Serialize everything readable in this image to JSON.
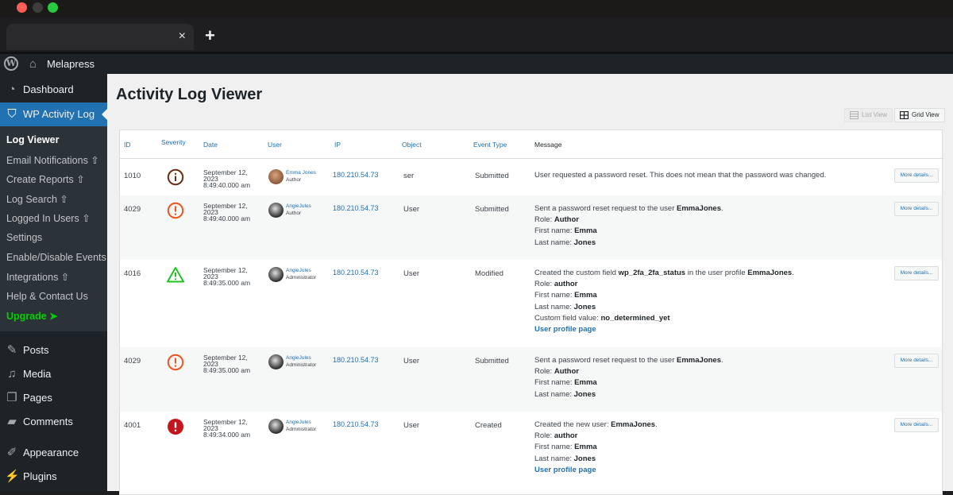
{
  "browser": {
    "window_controls": [
      {
        "name": "close",
        "color": "#ff5f57"
      },
      {
        "name": "minimize",
        "color": "#3d3d3d"
      },
      {
        "name": "maximize",
        "color": "#28c840"
      }
    ],
    "tab": {
      "title": "",
      "close_glyph": "×"
    },
    "new_tab_glyph": "+"
  },
  "admin_bar": {
    "wp_logo_glyph": "W",
    "home_glyph": "⌂",
    "site_name": "Melapress"
  },
  "sidebar": {
    "top_items": [
      {
        "label": "Dashboard",
        "icon": "dashboard-icon",
        "glyph": "◔"
      },
      {
        "label": "WP Activity Log",
        "icon": "shield-icon",
        "glyph": "⛉"
      }
    ],
    "submenu": [
      {
        "label": "Log Viewer",
        "suffix": ""
      },
      {
        "label": "Email Notifications",
        "suffix": " ⇧"
      },
      {
        "label": "Create Reports",
        "suffix": " ⇧"
      },
      {
        "label": "Log Search",
        "suffix": " ⇧"
      },
      {
        "label": "Logged In Users",
        "suffix": " ⇧"
      },
      {
        "label": "Settings",
        "suffix": ""
      },
      {
        "label": "Enable/Disable Events",
        "suffix": ""
      },
      {
        "label": "Integrations",
        "suffix": " ⇧"
      },
      {
        "label": "Help & Contact Us",
        "suffix": ""
      },
      {
        "label": "Upgrade",
        "suffix": " ➤"
      }
    ],
    "bottom_items": [
      {
        "label": "Posts",
        "icon": "pin-icon",
        "glyph": "✎"
      },
      {
        "label": "Media",
        "icon": "media-icon",
        "glyph": "♫"
      },
      {
        "label": "Pages",
        "icon": "pages-icon",
        "glyph": "❐"
      },
      {
        "label": "Comments",
        "icon": "comment-icon",
        "glyph": "▰"
      },
      {
        "label": "Appearance",
        "icon": "brush-icon",
        "glyph": "✐"
      },
      {
        "label": "Plugins",
        "icon": "plug-icon",
        "glyph": "⚡"
      }
    ]
  },
  "page": {
    "title": "Activity Log Viewer",
    "list_view_label": "List View",
    "grid_view_label": "Grid View"
  },
  "table": {
    "headers": [
      "ID",
      "Severity",
      "Date",
      "User",
      "IP",
      "Object",
      "Event Type",
      "Message"
    ],
    "more_label": "More details...",
    "rows": [
      {
        "id": "1010",
        "severity": "info",
        "date_l1": "September 12,",
        "date_l2": "2023",
        "date_l3": "8:49:40.000 am",
        "user": "Emma Jones",
        "role": "Author",
        "avatar": "#8a5a3c",
        "ip": "180.210.54.73",
        "object": "ser",
        "event_type": "Submitted",
        "message": [
          {
            "t": "User requested a password reset. This does not mean that the password was changed."
          }
        ]
      },
      {
        "id": "4029",
        "severity": "warning",
        "date_l1": "September 12,",
        "date_l2": "2023",
        "date_l3": "8:49:40.000 am",
        "user": "AngieJules",
        "role": "Author",
        "avatar": "#2a2a2a",
        "ip": "180.210.54.73",
        "object": "User",
        "event_type": "Submitted",
        "message": [
          {
            "t": "Sent a password reset request to the user ",
            "b": "EmmaJones",
            "e": "."
          },
          {
            "t": "Role: ",
            "b": "Author"
          },
          {
            "t": "First name: ",
            "b": "Emma"
          },
          {
            "t": "Last name: ",
            "b": "Jones"
          }
        ]
      },
      {
        "id": "4016",
        "severity": "notice",
        "date_l1": "September 12,",
        "date_l2": "2023",
        "date_l3": "8:49:35.000 am",
        "user": "AngieJules",
        "role": "Administrator",
        "avatar": "#2a2a2a",
        "ip": "180.210.54.73",
        "object": "User",
        "event_type": "Modified",
        "message": [
          {
            "t": "Created the custom field ",
            "b": "wp_2fa_2fa_status",
            "e": " in the user profile ",
            "b2": "EmmaJones",
            "e2": "."
          },
          {
            "t": "Role: ",
            "b": "author"
          },
          {
            "t": "First name: ",
            "b": "Emma"
          },
          {
            "t": "Last name: ",
            "b": "Jones"
          },
          {
            "t": "Custom field value: ",
            "b": "no_determined_yet"
          },
          {
            "link": "User profile page"
          }
        ]
      },
      {
        "id": "4029",
        "severity": "warning",
        "date_l1": "September 12,",
        "date_l2": "2023",
        "date_l3": "8:49:35.000 am",
        "user": "AngieJules",
        "role": "Administrator",
        "avatar": "#2a2a2a",
        "ip": "180.210.54.73",
        "object": "User",
        "event_type": "Submitted",
        "message": [
          {
            "t": "Sent a password reset request to the user ",
            "b": "EmmaJones",
            "e": "."
          },
          {
            "t": "Role: ",
            "b": "Author"
          },
          {
            "t": "First name: ",
            "b": "Emma"
          },
          {
            "t": "Last name: ",
            "b": "Jones"
          }
        ]
      },
      {
        "id": "4001",
        "severity": "critical",
        "date_l1": "September 12,",
        "date_l2": "2023",
        "date_l3": "8:49:34.000 am",
        "user": "AngieJules",
        "role": "Administrator",
        "avatar": "#2a2a2a",
        "ip": "180.210.54.73",
        "object": "User",
        "event_type": "Created",
        "message": [
          {
            "t": "Created the new user: ",
            "b": "EmmaJones",
            "e": "."
          },
          {
            "t": "Role: ",
            "b": "author"
          },
          {
            "t": "First name: ",
            "b": "Emma"
          },
          {
            "t": "Last name: ",
            "b": "Jones"
          },
          {
            "link": "User profile page"
          }
        ]
      }
    ]
  },
  "colors": {
    "accent": "#2271b1",
    "info": "#6b2e0f",
    "warning": "#f0541e",
    "notice": "#1ec31e",
    "critical": "#c4161c",
    "upgrade": "#00d000"
  }
}
